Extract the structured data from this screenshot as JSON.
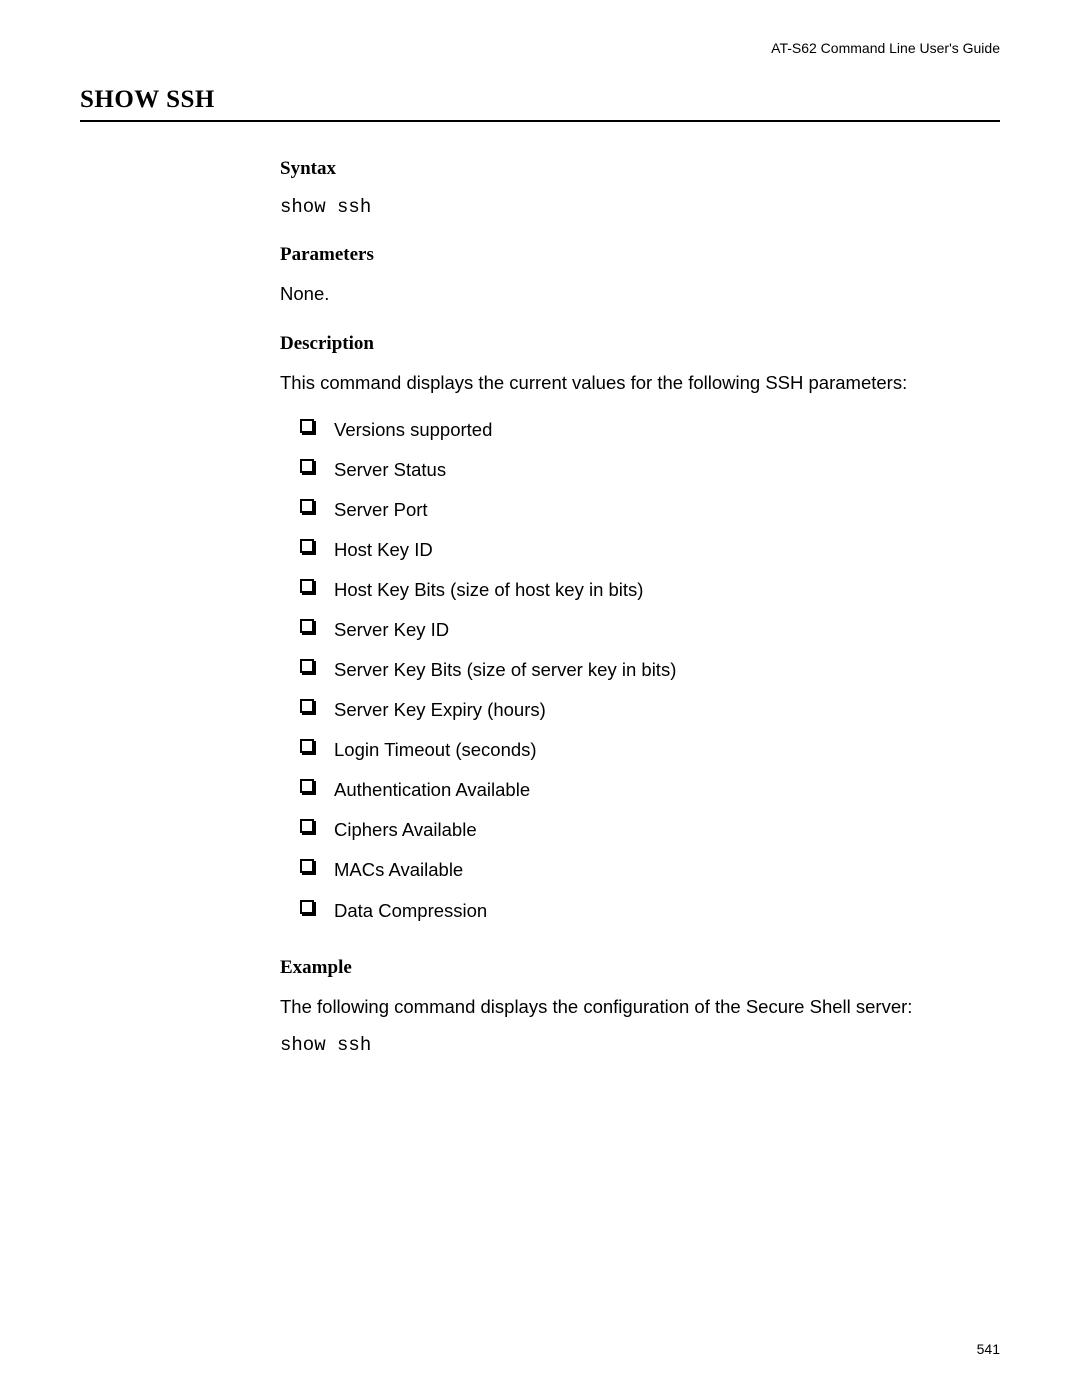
{
  "header": {
    "guide_title": "AT-S62 Command Line User's Guide"
  },
  "command": {
    "title": "SHOW SSH"
  },
  "sections": {
    "syntax": {
      "heading": "Syntax",
      "command": "show ssh"
    },
    "parameters": {
      "heading": "Parameters",
      "text": "None."
    },
    "description": {
      "heading": "Description",
      "intro": "This command displays the current values for the following SSH parameters:",
      "items": [
        "Versions supported",
        "Server Status",
        "Server Port",
        "Host Key ID",
        "Host Key Bits (size of host key in bits)",
        "Server Key ID",
        "Server Key Bits (size of server key in bits)",
        "Server Key Expiry (hours)",
        "Login Timeout (seconds)",
        "Authentication Available",
        "Ciphers Available",
        "MACs Available",
        "Data Compression"
      ]
    },
    "example": {
      "heading": "Example",
      "text": "The following command displays the configuration of the Secure Shell server:",
      "command": "show ssh"
    }
  },
  "footer": {
    "page_number": "541"
  }
}
